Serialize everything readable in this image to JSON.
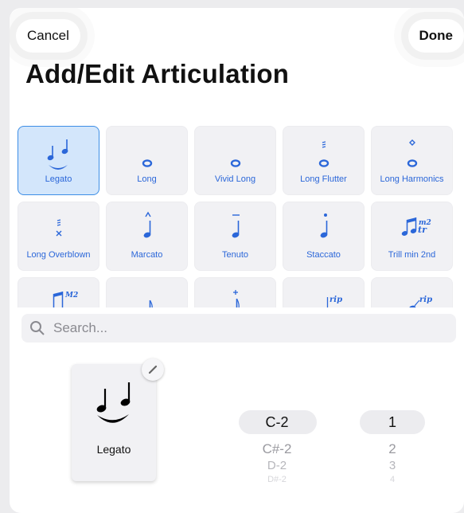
{
  "header": {
    "cancel_label": "Cancel",
    "done_label": "Done",
    "title": "Add/Edit Articulation"
  },
  "articulations": [
    {
      "label": "Legato",
      "icon": "legato-icon",
      "selected": true
    },
    {
      "label": "Long",
      "icon": "whole-note-icon"
    },
    {
      "label": "Vivid Long",
      "icon": "whole-note-icon"
    },
    {
      "label": "Long Flutter",
      "icon": "flutter-whole-note-icon"
    },
    {
      "label": "Long Harmonics",
      "icon": "harmonic-whole-note-icon"
    },
    {
      "label": "Long Overblown",
      "icon": "overblown-icon"
    },
    {
      "label": "Marcato",
      "icon": "marcato-note-icon"
    },
    {
      "label": "Tenuto",
      "icon": "tenuto-note-icon"
    },
    {
      "label": "Staccato",
      "icon": "staccato-note-icon"
    },
    {
      "label": "Trill min 2nd",
      "icon": "trill-icon",
      "text": "m2"
    },
    {
      "label": "",
      "icon": "trill-major-icon",
      "text": "M2"
    },
    {
      "label": "",
      "icon": "note-icon"
    },
    {
      "label": "",
      "icon": "plus-note-icon"
    },
    {
      "label": "",
      "icon": "rip-icon",
      "text": "rip"
    },
    {
      "label": "",
      "icon": "rip-note-icon",
      "text": "rip"
    }
  ],
  "search": {
    "placeholder": "Search..."
  },
  "preview": {
    "label": "Legato",
    "icon": "legato-icon"
  },
  "pitch_picker": {
    "items": [
      "C-2",
      "C#-2",
      "D-2",
      "D#-2"
    ],
    "selected": "C-2"
  },
  "number_picker": {
    "items": [
      "1",
      "2",
      "3",
      "4"
    ],
    "selected": "1"
  },
  "colors": {
    "accent": "#2b67d9",
    "selected_bg": "#d3e6fb",
    "cell_bg": "#f1f1f4"
  }
}
